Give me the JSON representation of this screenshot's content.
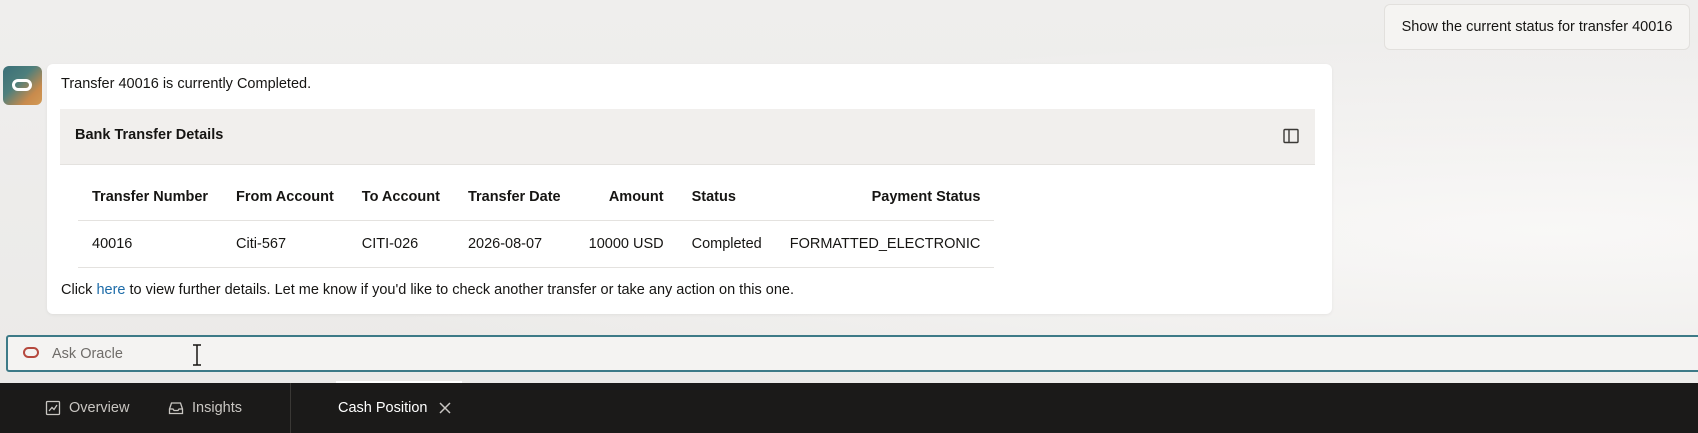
{
  "chat": {
    "user_message": "Show the current status for transfer 40016",
    "assistant_message": "Transfer 40016 is currently Completed.",
    "details_title": "Bank Transfer Details",
    "table": {
      "headers": {
        "transfer_number": "Transfer Number",
        "from_account": "From Account",
        "to_account": "To Account",
        "transfer_date": "Transfer Date",
        "amount": "Amount",
        "status": "Status",
        "payment_status": "Payment Status"
      },
      "rows": [
        {
          "transfer_number": "40016",
          "from_account": "Citi-567",
          "to_account": "CITI-026",
          "transfer_date": "2026-08-07",
          "amount": "10000 USD",
          "status": "Completed",
          "payment_status": "FORMATTED_ELECTRONIC"
        }
      ]
    },
    "footer_prefix": "Click ",
    "footer_link": "here",
    "footer_suffix": " to view further details. Let me know if you'd like to check another transfer or take any action on this one."
  },
  "ask": {
    "placeholder": "Ask Oracle",
    "value": ""
  },
  "bottom_nav": {
    "overview_label": "Overview",
    "insights_label": "Insights",
    "active_tab_label": "Cash Position"
  },
  "icons": {
    "panel": "panel-toggle-icon",
    "oracle": "oracle-ring-icon",
    "overview": "chart-icon",
    "insights": "inbox-icon",
    "close": "close-icon"
  },
  "colors": {
    "accent": "#3d7a87",
    "link": "#1c6ba8",
    "oracle_red": "#b5483e",
    "nav_bg": "#1b1a19"
  }
}
